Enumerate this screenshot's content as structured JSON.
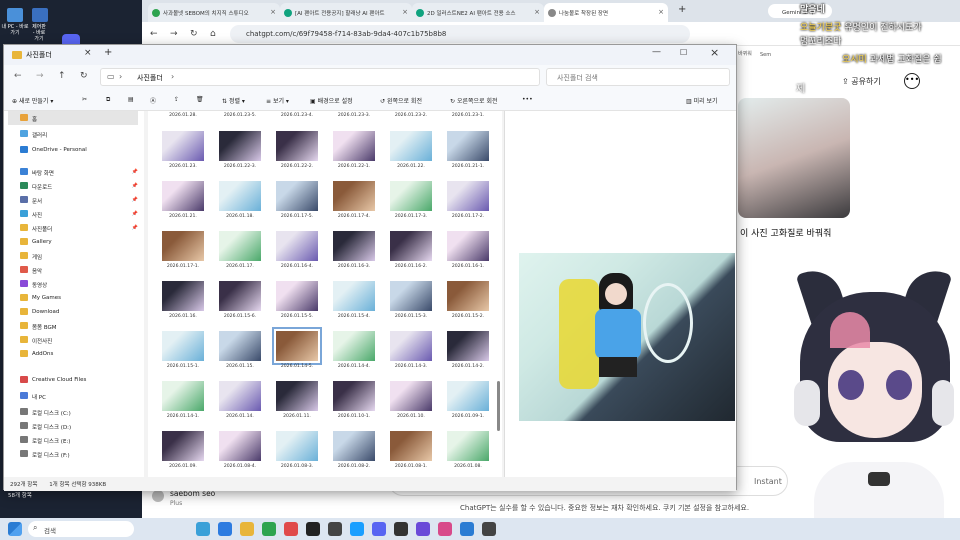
{
  "desktop": {
    "icons": [
      {
        "label": "내 PC - 바로 가기"
      },
      {
        "label": "제어판 - 바로 가기"
      }
    ]
  },
  "browser": {
    "tabs": [
      {
        "label": "사과볼넷 SEBOM의 치지직 스튜디오",
        "color": "#2ea44f"
      },
      {
        "label": "[AI 팬아트 전용공지] 할래냥 AI 팬아트",
        "color": "#10a37f"
      },
      {
        "label": "2D 일러스트NE2 AI 팬아트 전용 소스",
        "color": "#10a37f"
      },
      {
        "label": "나눔볼로 착장된 장면",
        "color": "#888888",
        "active": true
      }
    ],
    "add_tab": "+",
    "gemini_tab": "Gemini 보기",
    "url": "chatgpt.com/c/69f79458-f714-83ab-9da4-407c1b75b8b8",
    "chat": {
      "share_label": "공유하기",
      "sidebar_label": "바뀌워",
      "sidebar_label2": "Sem",
      "message_text": "이 사진 고화질로 바꿔줘",
      "input_placeholder": "Instant",
      "footer_note": "ChatGPT는 실수를 할 수 있습니다. 중요한 정보는 재차 확인하세요. 쿠키 기본 설정을 참고하세요.",
      "user_name": "saebom seo",
      "user_plan": "Plus"
    }
  },
  "explorer": {
    "title": "사진폴더",
    "path": "사진폴더",
    "search_placeholder": "사진폴더 검색",
    "toolbar": {
      "new": "새로 만들기",
      "sort": "정렬",
      "view": "보기",
      "set_bg": "배경으로 설정",
      "rotate_left": "왼쪽으로 회전",
      "rotate_right": "오른쪽으로 회전",
      "more": "•••",
      "preview": "미리 보기"
    },
    "sidebar": [
      {
        "label": "홈",
        "color": "#e8a23a"
      },
      {
        "label": "갤러리",
        "color": "#4fa3e0"
      },
      {
        "label": "OneDrive - Personal",
        "color": "#2b7cd3"
      },
      {
        "label": "바탕 화면",
        "color": "#3b82d6"
      },
      {
        "label": "다운로드",
        "color": "#2b8a5a"
      },
      {
        "label": "문서",
        "color": "#5a6fa8"
      },
      {
        "label": "사진",
        "color": "#3aa0d8"
      },
      {
        "label": "사진폴더",
        "color": "#e8b53a"
      },
      {
        "label": "Gallery",
        "color": "#e8b53a"
      },
      {
        "label": "게임",
        "color": "#e8b53a"
      },
      {
        "label": "음악",
        "color": "#e05a4a"
      },
      {
        "label": "동영상",
        "color": "#8a4ad8"
      },
      {
        "label": "My Games",
        "color": "#e8b53a"
      },
      {
        "label": "Download",
        "color": "#e8b53a"
      },
      {
        "label": "봄봄 BGM",
        "color": "#e8b53a"
      },
      {
        "label": "이전사진",
        "color": "#e8b53a"
      },
      {
        "label": "AddOns",
        "color": "#e8b53a"
      },
      {
        "label": "Creative Cloud Files",
        "color": "#d84a4a"
      },
      {
        "label": "내 PC",
        "color": "#4a7ad8"
      },
      {
        "label": "로컬 디스크 (C:)",
        "color": "#777777"
      },
      {
        "label": "로컬 디스크 (D:)",
        "color": "#777777"
      },
      {
        "label": "로컬 디스크 (E:)",
        "color": "#777777"
      },
      {
        "label": "로컬 디스크 (F:)",
        "color": "#777777"
      }
    ],
    "top_captions": [
      "2026.01.28.",
      "2026.01.23-5.",
      "2026.01.23-4.",
      "2026.01.23-3.",
      "2026.01.23-2.",
      "2026.01.23-1."
    ],
    "rows": [
      [
        "2026.01.23.",
        "2026.01.22-3.",
        "2026.01.22-2.",
        "2026.01.22-1.",
        "2026.01.22.",
        "2026.01.21-1."
      ],
      [
        "2026.01.21.",
        "2026.01.18.",
        "2026.01.17-5.",
        "2026.01.17-4.",
        "2026.01.17-3.",
        "2026.01.17-2."
      ],
      [
        "2026.01.17-1.",
        "2026.01.17.",
        "2026.01.16-4.",
        "2026.01.16-3.",
        "2026.01.16-2.",
        "2026.01.16-1."
      ],
      [
        "2026.01.16.",
        "2026.01.15-6.",
        "2026.01.15-5.",
        "2026.01.15-4.",
        "2026.01.15-3.",
        "2026.01.15-2."
      ],
      [
        "2026.01.15-1.",
        "2026.01.15.",
        "2026.01.14-5.",
        "2026.01.14-4.",
        "2026.01.14-3.",
        "2026.01.14-2."
      ],
      [
        "2026.01.14-1.",
        "2026.01.14.",
        "2026.01.11.",
        "2026.01.10-1.",
        "2026.01.10.",
        "2026.01.09-1."
      ],
      [
        "2026.01.09.",
        "2026.01.08-4.",
        "2026.01.08-3.",
        "2026.01.08-2.",
        "2026.01.08-1.",
        "2026.01.08."
      ]
    ],
    "status_left": "292개 항목",
    "status_sel": "1개 항목 선택함 938KB",
    "status_bottom": "58개 항목"
  },
  "stream_overlay": {
    "chat_lines": [
      {
        "name": "말음네",
        "text": ""
      },
      {
        "name": "오늘기분굿",
        "text": "유명인이 전하시도가"
      },
      {
        "name": "",
        "text": "멍꼬리조다"
      },
      {
        "name": "오시미",
        "text": "과세법 고화질은 쉽"
      },
      {
        "name": "",
        "text": "제"
      }
    ]
  },
  "taskbar": {
    "search_placeholder": "검색"
  }
}
